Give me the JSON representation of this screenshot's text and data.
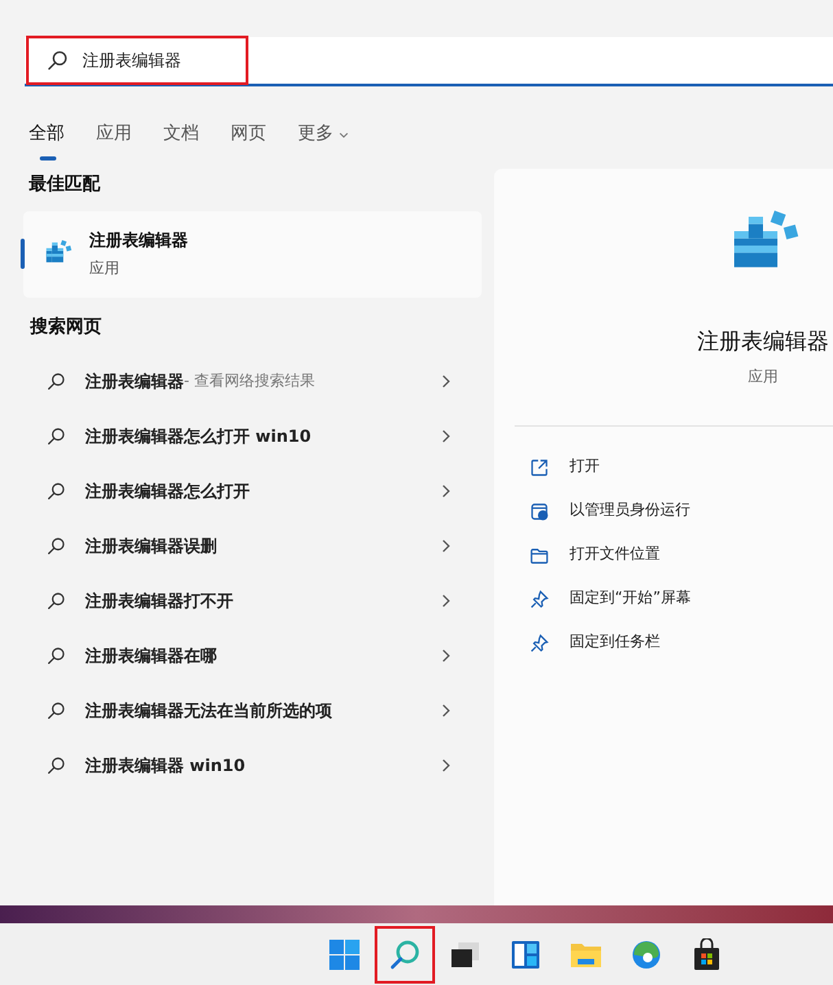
{
  "search": {
    "value": "注册表编辑器"
  },
  "tabs": [
    {
      "label": "全部",
      "selected": true
    },
    {
      "label": "应用",
      "selected": false
    },
    {
      "label": "文档",
      "selected": false
    },
    {
      "label": "网页",
      "selected": false
    },
    {
      "label": "更多",
      "selected": false,
      "dropdown": true
    }
  ],
  "best_match": {
    "heading": "最佳匹配",
    "title": "注册表编辑器",
    "subtitle": "应用",
    "selected": true
  },
  "web_search": {
    "heading": "搜索网页",
    "items": [
      {
        "text": "注册表编辑器",
        "suffix": " - 查看网络搜索结果"
      },
      {
        "text": "注册表编辑器怎么打开 win10"
      },
      {
        "text": "注册表编辑器怎么打开"
      },
      {
        "text": "注册表编辑器误删"
      },
      {
        "text": "注册表编辑器打不开"
      },
      {
        "text": "注册表编辑器在哪"
      },
      {
        "text": "注册表编辑器无法在当前所选的项"
      },
      {
        "text": "注册表编辑器 win10"
      }
    ]
  },
  "details": {
    "title": "注册表编辑器",
    "subtitle": "应用",
    "actions": [
      {
        "kind": "open",
        "label": "打开"
      },
      {
        "kind": "admin",
        "label": "以管理员身份运行"
      },
      {
        "kind": "folder",
        "label": "打开文件位置"
      },
      {
        "kind": "pin",
        "label": "固定到“开始”屏幕"
      },
      {
        "kind": "pin",
        "label": "固定到任务栏"
      }
    ]
  },
  "taskbar": [
    {
      "kind": "start",
      "highlighted": false
    },
    {
      "kind": "search",
      "highlighted": true
    },
    {
      "kind": "taskview",
      "highlighted": false
    },
    {
      "kind": "widgets",
      "highlighted": false
    },
    {
      "kind": "explorer",
      "highlighted": false
    },
    {
      "kind": "edge",
      "highlighted": false
    },
    {
      "kind": "store",
      "highlighted": false
    }
  ]
}
